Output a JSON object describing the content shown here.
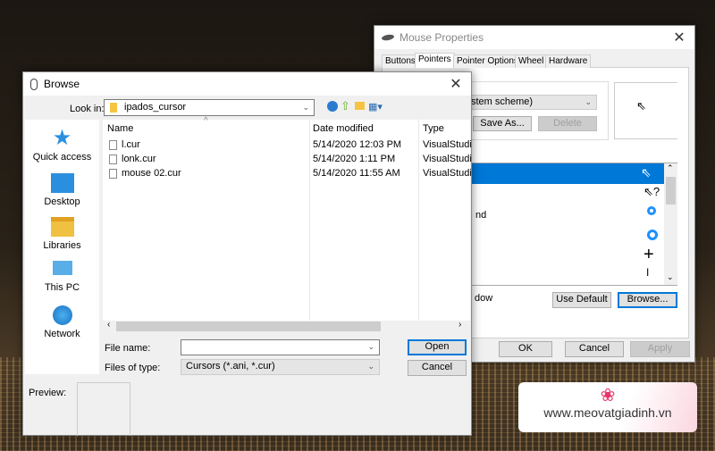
{
  "mouse_properties": {
    "title": "Mouse Properties",
    "tabs": [
      "Buttons",
      "Pointers",
      "Pointer Options",
      "Wheel",
      "Hardware"
    ],
    "active_tab": "Pointers",
    "scheme_value": "stem scheme)",
    "save_as": "Save As...",
    "delete": "Delete",
    "list_partial": [
      "nd"
    ],
    "shadow_label_partial": "dow",
    "use_default": "Use Default",
    "browse": "Browse...",
    "ok": "OK",
    "cancel": "Cancel",
    "apply": "Apply",
    "selection_color": "#0078d7"
  },
  "browse": {
    "title": "Browse",
    "look_in_label": "Look in:",
    "look_in_value": "ipados_cursor",
    "toolbar_icons": [
      "back-icon",
      "up-folder-icon",
      "new-folder-icon",
      "view-menu-icon"
    ],
    "places": [
      {
        "label": "Quick access",
        "icon": "star-icon"
      },
      {
        "label": "Desktop",
        "icon": "desktop-icon"
      },
      {
        "label": "Libraries",
        "icon": "libraries-icon"
      },
      {
        "label": "This PC",
        "icon": "computer-icon"
      },
      {
        "label": "Network",
        "icon": "network-icon"
      }
    ],
    "columns": [
      "Name",
      "Date modified",
      "Type"
    ],
    "files": [
      {
        "name": "l.cur",
        "date": "5/14/2020 12:03 PM",
        "type": "VisualStudi"
      },
      {
        "name": "lonk.cur",
        "date": "5/14/2020 1:11 PM",
        "type": "VisualStudi"
      },
      {
        "name": "mouse 02.cur",
        "date": "5/14/2020 11:55 AM",
        "type": "VisualStudi"
      }
    ],
    "file_name_label": "File name:",
    "file_name_value": "",
    "files_of_type_label": "Files of type:",
    "files_of_type_value": "Cursors (*.ani, *.cur)",
    "open": "Open",
    "cancel": "Cancel",
    "preview_label": "Preview:"
  },
  "watermark": {
    "text": "www.meovatgiadinh.vn"
  }
}
